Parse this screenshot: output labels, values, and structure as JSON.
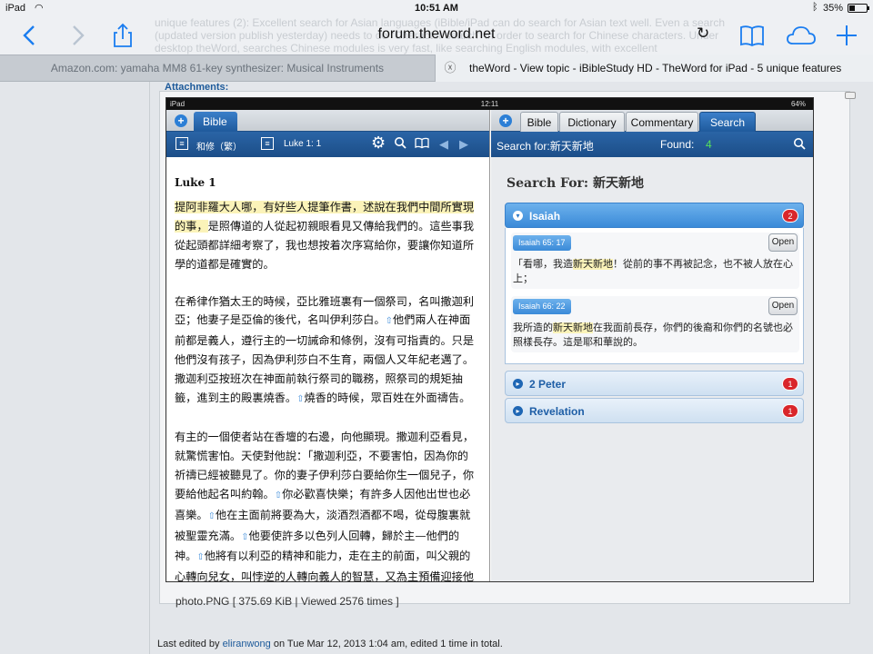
{
  "status_bar": {
    "device": "iPad",
    "time": "10:51 AM",
    "battery_text": "35%",
    "battery_level": 0.35
  },
  "toolbar": {
    "url": "forum.theword.net",
    "ghost_lines": [
      "unique features (2): Excellent search for Asian languages (iBible/iPad can do search for Asian text well. Even a search",
      "(updated version publish yesterday) needs to do \"Character search\" in order to search for Chinese characters. Under",
      "desktop theWord, searches Chinese modules is very fast, like searching English modules, with excellent"
    ]
  },
  "tabs": {
    "tab1_title": "Amazon.com: yamaha MM8 61-key synthesizer: Musical Instruments",
    "tab2_title": "theWord - View topic - iBibleStudy HD - TheWord for iPad - 5 unique features",
    "close_glyph": "ⓧ"
  },
  "post": {
    "attachments_label": "Attachments:",
    "file_info": "photo.PNG [ 375.69 KiB | Viewed 2576 times ]",
    "edit_prefix": "Last edited by ",
    "edit_user": "eliranwong",
    "edit_suffix": " on Tue Mar 12, 2013 1:04 am, edited 1 time in total."
  },
  "shot": {
    "status": {
      "device": "iPad",
      "time": "12:11",
      "battery": "64%"
    },
    "left": {
      "tab": "Bible",
      "version": "和修（繁）",
      "reference": "Luke 1: 1",
      "heading": "Luke 1",
      "para1_highlight": "提阿非羅大人哪，有好些人提筆作書，述說在我們中間所實現的事，",
      "para1_rest": "是照傳道的人從起初親眼看見又傳給我們的。這些事我從起頭都詳細考察了，我也想按着次序寫給你，要讓你知道所學的道都是確實的。",
      "para2a": "在希律作猶太王的時候，亞比雅班裏有一個祭司，名叫撒迦利亞；他妻子是亞倫的後代，名叫伊利莎白。",
      "para2b": "他們兩人在神面前都是義人，遵行主的一切誡命和條例，沒有可指責的。只是他們沒有孩子，因為伊利莎白不生育，兩個人又年紀老邁了。撒迦利亞按班次在神面前執行祭司的職務，照祭司的規矩抽籤，進到主的殿裏燒香。",
      "para2c": "燒香的時候，眾百姓在外面禱告。",
      "para3a": "有主的一個使者站在香壇的右邊，向他顯現。撒迦利亞看見，就驚慌害怕。天使對他說：「撒迦利亞，不要害怕，因為你的祈禱已經被聽見了。你的妻子伊利莎白要給你生一個兒子，你要給他起名叫約翰。",
      "para3b": "你必歡喜快樂；有許多人因他出世也必喜樂。",
      "para3c": "他在主面前將要為大，淡酒烈酒都不喝，從母腹裏就被聖靈充滿。",
      "para3d": "他要使許多以色列人回轉，歸於主—他們的神。",
      "para3e": "他將有以利亞的精神和能力，走在主的前面，叫父親的心轉向兒女，叫悖逆的人轉向義人的智慧，又為主預備迎接他的百姓。」",
      "arrow_glyph": "⇧"
    },
    "right": {
      "tabs": [
        "Bible",
        "Dictionary",
        "Commentary",
        "Search"
      ],
      "search_for": "Search for:新天新地",
      "found_label": "Found:",
      "found_count": "4",
      "heading": "Search For: 新天新地",
      "groups": [
        {
          "name": "Isaiah",
          "count": "2"
        },
        {
          "name": "2 Peter",
          "count": "1"
        },
        {
          "name": "Revelation",
          "count": "1"
        }
      ],
      "results": [
        {
          "ref": "Isaiah 65: 17",
          "open": "Open",
          "text_before": "「看哪，我造",
          "match": "新天新地",
          "text_after": "！從前的事不再被記念，也不被人放在心上；"
        },
        {
          "ref": "Isaiah 66: 22",
          "open": "Open",
          "text_before": "我所造的",
          "match": "新天新地",
          "text_after": "在我面前長存，你們的後裔和你們的名號也必照樣長存。這是耶和華說的。"
        }
      ]
    }
  },
  "colors": {
    "accent": "#1a7df0",
    "bar_blue": "#1f5a9c",
    "badge_red": "#d9262b",
    "found_green": "#55e05a",
    "highlight": "#fbf3b9"
  }
}
